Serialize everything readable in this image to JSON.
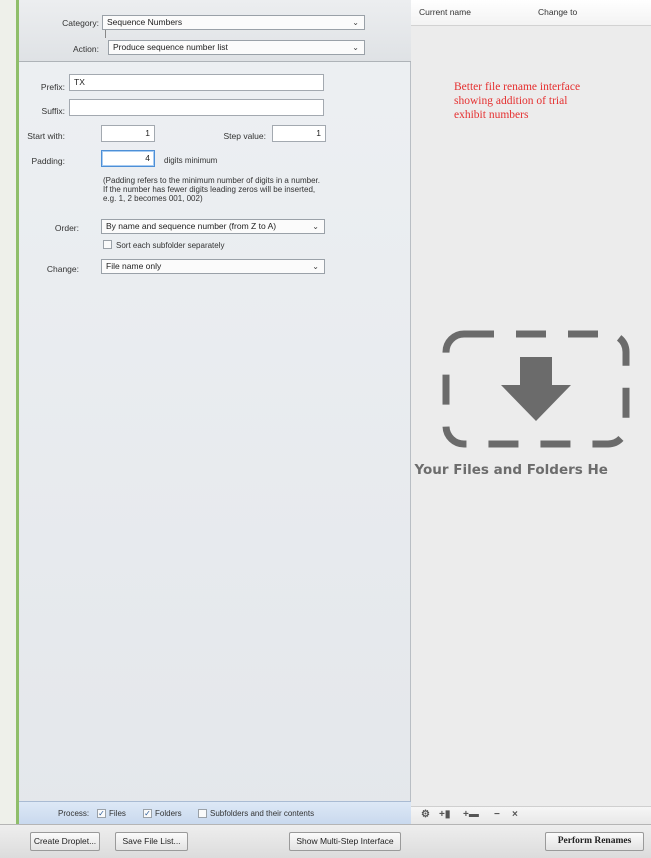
{
  "rename_settings": {
    "category_label": "Category:",
    "category_value": "Sequence Numbers",
    "action_label": "Action:",
    "action_value": "Produce sequence number list",
    "prefix_label": "Prefix:",
    "prefix_value": "TX",
    "suffix_label": "Suffix:",
    "suffix_value": "",
    "start_label": "Start with:",
    "start_value": "1",
    "step_label": "Step value:",
    "step_value": "1",
    "padding_label": "Padding:",
    "padding_value": "4",
    "padding_suffix": "digits minimum",
    "padding_note_1": "(Padding refers to the minimum number of digits in a number.",
    "padding_note_2": "If the number has fewer digits leading zeros will be inserted,",
    "padding_note_3": "e.g. 1, 2 becomes 001, 002)",
    "order_label": "Order:",
    "order_value": "By name and sequence number (from Z to A)",
    "sort_subfolder_label": "Sort each subfolder separately",
    "sort_subfolder_checked": false,
    "change_label": "Change:",
    "change_value": "File name only"
  },
  "process": {
    "label": "Process:",
    "files_label": "Files",
    "files_checked": true,
    "folders_label": "Folders",
    "folders_checked": true,
    "subfolders_label": "Subfolders and their contents",
    "subfolders_checked": false
  },
  "file_list": {
    "col_current": "Current name",
    "col_change": "Change to",
    "drop_text": "ag Your Files and Folders He",
    "drop_icon": "download-arrow-icon",
    "toolbar_icons": [
      "gear-icon",
      "add-file-icon",
      "add-folder-icon",
      "minus-icon",
      "close-icon"
    ]
  },
  "annotation": {
    "line1": "Better file rename interface",
    "line2": "showing addition of trial",
    "line3": "exhibit numbers"
  },
  "buttons": {
    "create_droplet": "Create Droplet...",
    "save_file_list": "Save File List...",
    "multi_step": "Show Multi-Step Interface",
    "perform": "Perform Renames"
  },
  "colors": {
    "accent_green": "#8fbe6a",
    "annotation_red": "#e53030",
    "process_bar_blue": "#c9d9ee"
  }
}
